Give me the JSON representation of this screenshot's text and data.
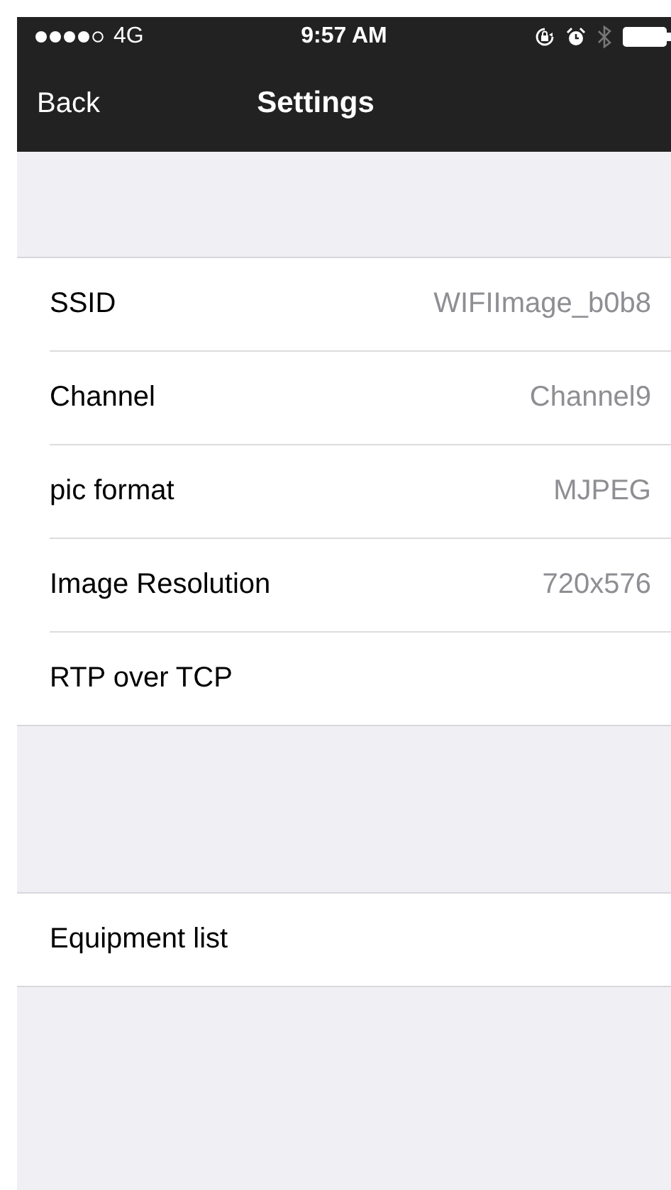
{
  "status_bar": {
    "carrier": "4G",
    "time": "9:57 AM"
  },
  "nav": {
    "back": "Back",
    "title": "Settings"
  },
  "sections": [
    {
      "rows": [
        {
          "label": "SSID",
          "value": "WIFIImage_b0b8"
        },
        {
          "label": "Channel",
          "value": "Channel9"
        },
        {
          "label": "pic format",
          "value": "MJPEG"
        },
        {
          "label": "Image Resolution",
          "value": "720x576"
        },
        {
          "label": "RTP over TCP"
        }
      ]
    },
    {
      "rows": [
        {
          "label": "Equipment list"
        }
      ]
    }
  ]
}
